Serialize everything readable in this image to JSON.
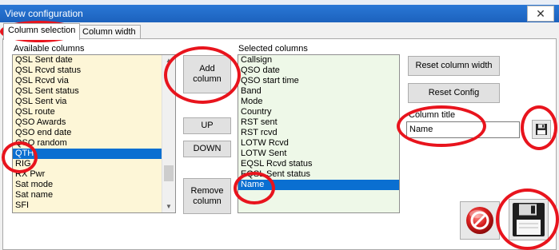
{
  "window": {
    "title": "View configuration",
    "close_glyph": "✕"
  },
  "tabs": [
    {
      "label": "Column selection",
      "active": true
    },
    {
      "label": "Column width",
      "active": false
    }
  ],
  "available": {
    "label": "Available columns",
    "items": [
      "QSL Sent date",
      "QSL Rcvd status",
      "QSL Rcvd via",
      "QSL Sent status",
      "QSL Sent via",
      "QSL route",
      "QSO Awards",
      "QSO end date",
      "QSO random",
      "QTH",
      "RIG",
      "RX Pwr",
      "Sat mode",
      "Sat name",
      "SFI"
    ],
    "selected_index": 9
  },
  "selected": {
    "label": "Selected columns",
    "items": [
      "Callsign",
      "QSO date",
      "QSO start time",
      "Band",
      "Mode",
      "Country",
      "RST sent",
      "RST rcvd",
      "LOTW Rcvd",
      "LOTW Sent",
      "EQSL Rcvd status",
      "EQSL Sent status",
      "Name"
    ],
    "selected_index": 12
  },
  "buttons": {
    "add": "Add column",
    "up": "UP",
    "down": "DOWN",
    "remove": "Remove column",
    "reset_width": "Reset column width",
    "reset_config": "Reset Config"
  },
  "column_title": {
    "label": "Column title",
    "value": "Name"
  },
  "icons": {
    "save_small": "floppy-disk-icon",
    "cancel": "cancel-icon",
    "save_large": "floppy-disk-icon"
  },
  "colors": {
    "accent": "#0a6fd1",
    "titlebar": "#1c62bd",
    "annotation": "#e8141d"
  }
}
